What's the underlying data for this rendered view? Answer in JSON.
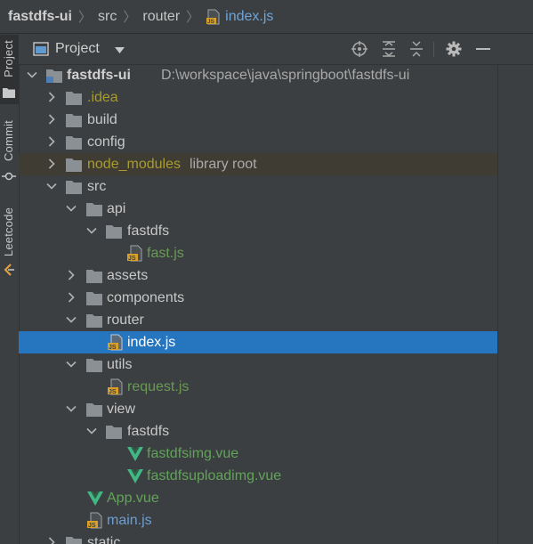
{
  "breadcrumb": {
    "project": "fastdfs-ui",
    "src": "src",
    "router": "router",
    "file": "index.js"
  },
  "strip": {
    "project": "Project",
    "commit": "Commit",
    "leetcode": "Leetcode"
  },
  "panel": {
    "title": "Project",
    "icons": [
      "locate-icon",
      "expand-all-icon",
      "collapse-all-icon",
      "settings-icon",
      "minimize-icon"
    ]
  },
  "tree": {
    "root_name": "fastdfs-ui",
    "root_path": "D:\\workspace\\java\\springboot\\fastdfs-ui",
    "idea": ".idea",
    "build": "build",
    "config": "config",
    "node_modules": "node_modules",
    "node_modules_hint": "library root",
    "src": "src",
    "api": "api",
    "api_fastdfs": "fastdfs",
    "fast_js": "fast.js",
    "assets": "assets",
    "components": "components",
    "router": "router",
    "index_js": "index.js",
    "utils": "utils",
    "request_js": "request.js",
    "view": "view",
    "view_fastdfs": "fastdfs",
    "fastdfsimg_vue": "fastdfsimg.vue",
    "fastdfsuploadimg_vue": "fastdfsuploadimg.vue",
    "app_vue": "App.vue",
    "main_js": "main.js",
    "static": "static"
  },
  "colors": {
    "selection": "#2675bf",
    "folder": "#8b9095",
    "js_badge": "#d8a02b",
    "vue": "#41b883"
  }
}
